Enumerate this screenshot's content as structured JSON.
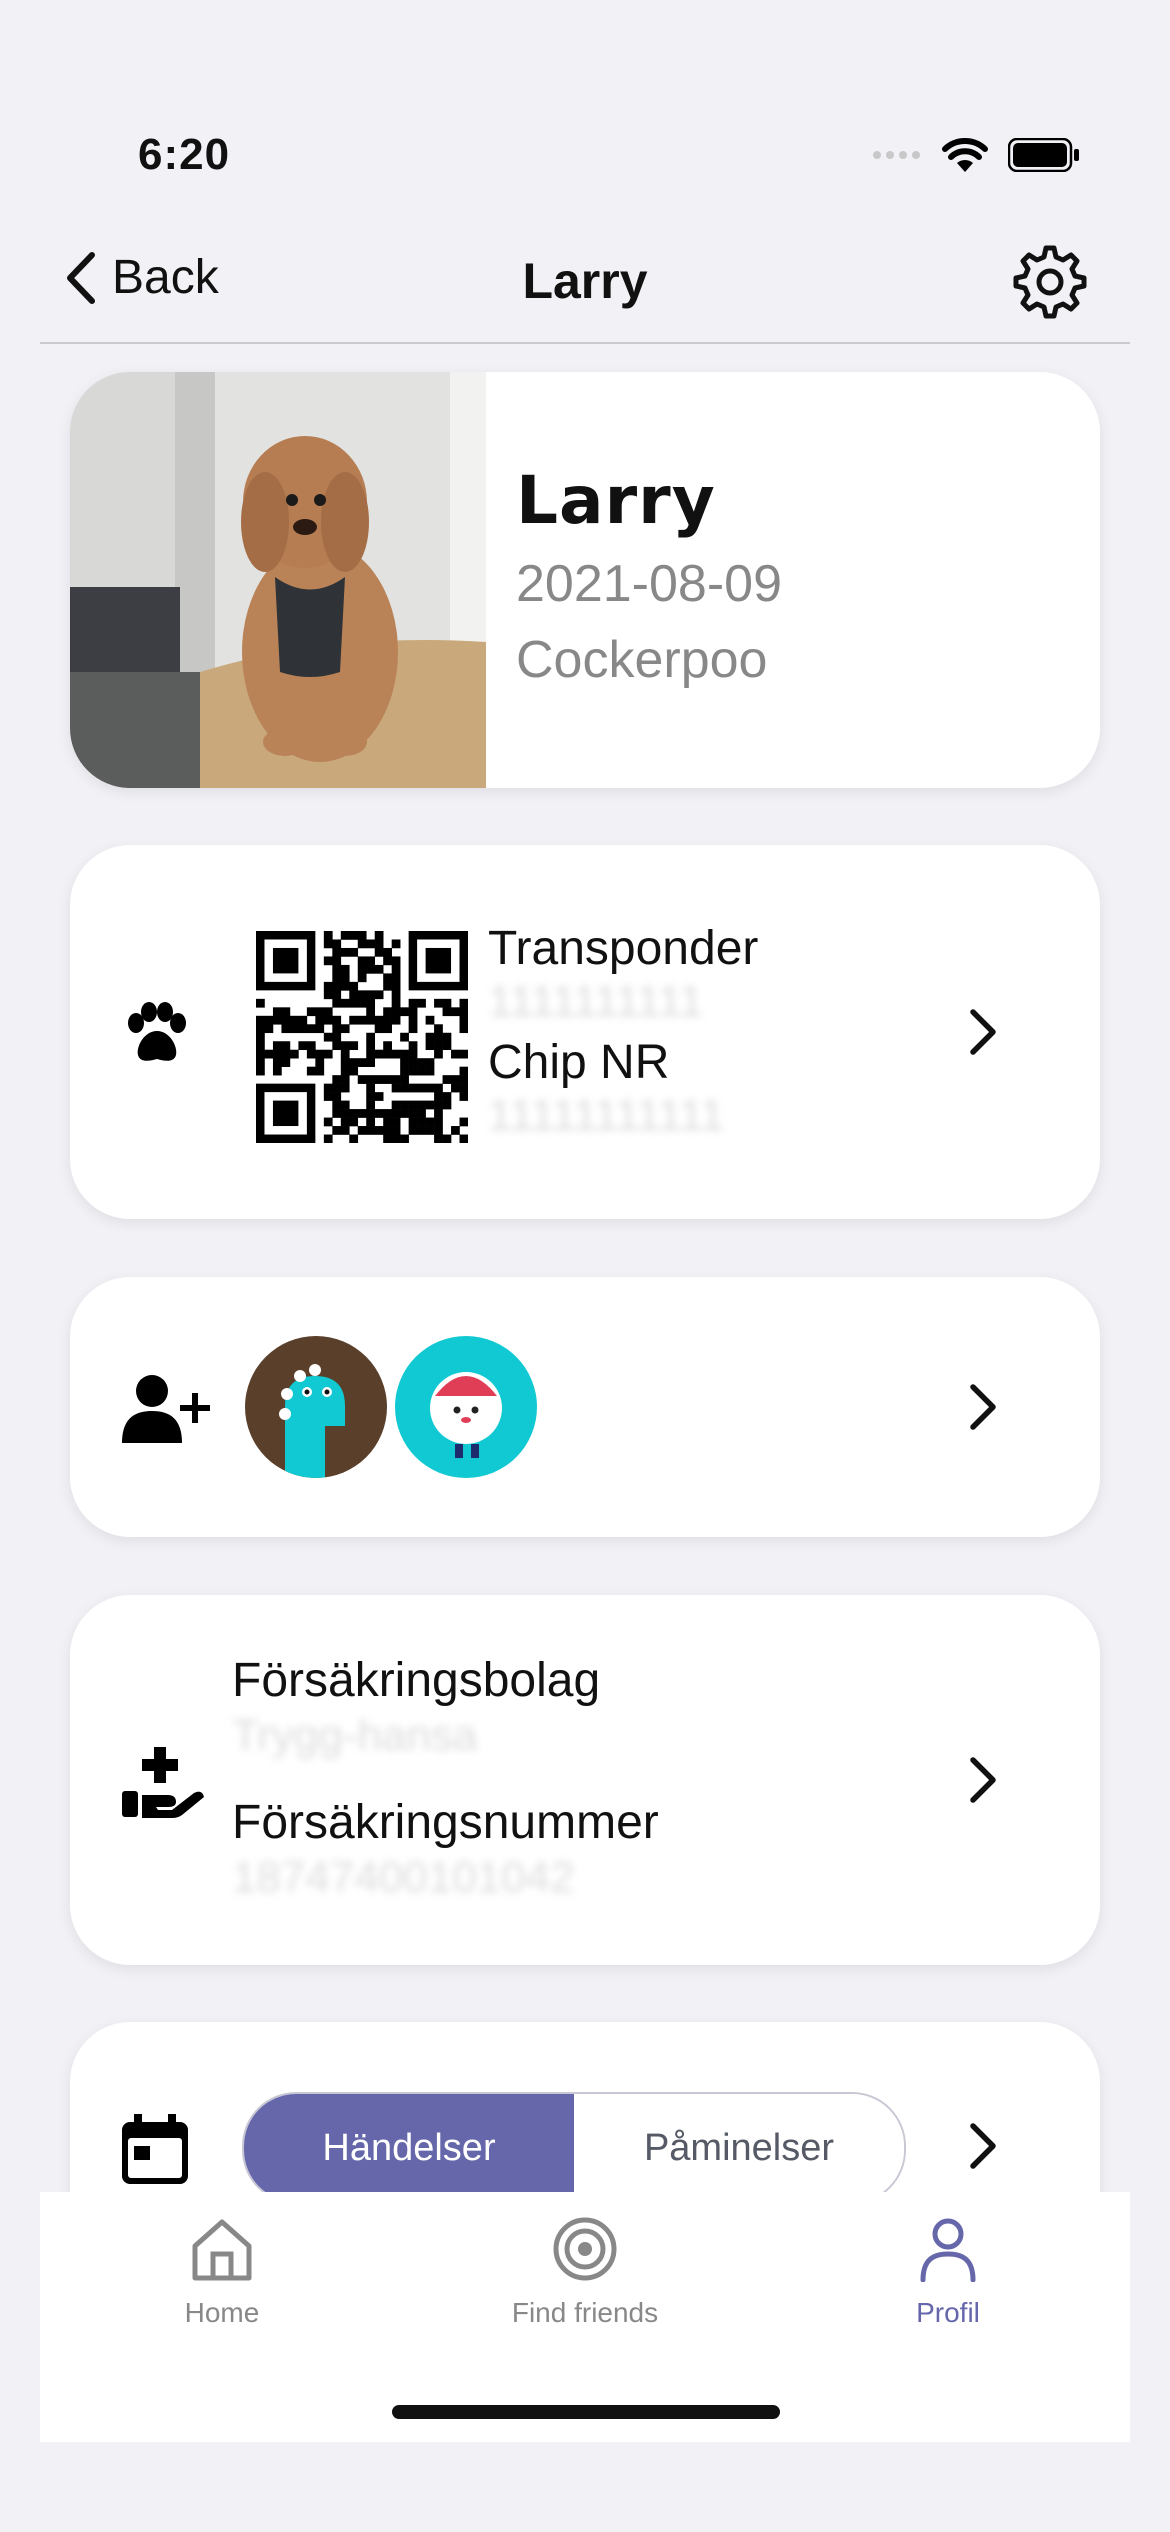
{
  "status_bar": {
    "time": "6:20"
  },
  "nav": {
    "back_label": "Back",
    "title": "Larry"
  },
  "profile": {
    "name": "Larry",
    "birth_date": "2021-08-09",
    "breed": "Cockerpoo"
  },
  "identification": {
    "transponder_label": "Transponder",
    "transponder_value": "1111111111",
    "chip_label": "Chip NR",
    "chip_value": "11111111111"
  },
  "sharing": {
    "avatars": [
      "dino-avatar",
      "character-avatar"
    ]
  },
  "insurance": {
    "company_label": "Försäkringsbolag",
    "company_value": "Trygg-hansa",
    "number_label": "Försäkringsnummer",
    "number_value": "18747400101042"
  },
  "calendar": {
    "tab_events": "Händelser",
    "tab_reminders": "Påminelser",
    "active_tab": "Händelser"
  },
  "tabbar": {
    "items": [
      {
        "label": "Home",
        "icon": "home-icon",
        "active": false
      },
      {
        "label": "Find friends",
        "icon": "target-icon",
        "active": false
      },
      {
        "label": "Profil",
        "icon": "person-icon",
        "active": true
      }
    ]
  },
  "colors": {
    "accent": "#6667ab",
    "background": "#f1f1f6",
    "card": "#ffffff",
    "avatar_cyan": "#11c9d3"
  }
}
